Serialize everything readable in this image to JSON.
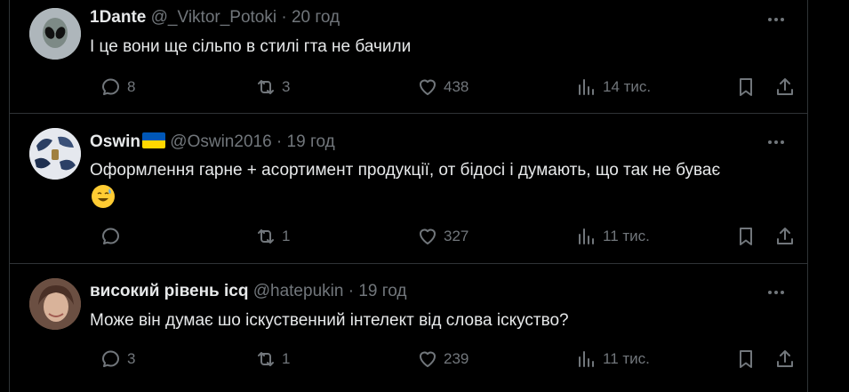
{
  "tweets": [
    {
      "name": "1Dante",
      "handle": "@_Viktor_Potoki",
      "separator": "·",
      "time": "20 год",
      "text": "І це вони ще сільпо в стилі гта не бачили",
      "replies": "8",
      "reposts": "3",
      "likes": "438",
      "views": "14 тис.",
      "avatar_icon": "alien-icon",
      "avatar_color": "#b9c0c5"
    },
    {
      "name": "Oswin",
      "name_flag": "ukraine-flag",
      "handle": "@Oswin2016",
      "separator": "·",
      "time": "19 год",
      "text": "Оформлення гарне + асортимент продукції, от бідосі і думають, що так не буває",
      "text_emoji": "grinning-sweat-emoji",
      "replies": "",
      "reposts": "1",
      "likes": "327",
      "views": "11 тис.",
      "avatar_icon": "artwork-avatar",
      "avatar_color": "#d9dde4"
    },
    {
      "name": "високий рівень icq",
      "handle": "@hatepukin",
      "separator": "·",
      "time": "19 год",
      "text": "Може він думає шо іскуственний інтелект від слова іскуство?",
      "replies": "3",
      "reposts": "1",
      "likes": "239",
      "views": "11 тис.",
      "avatar_icon": "photo-avatar",
      "avatar_color": "#8a6a58"
    }
  ],
  "colors": {
    "background": "#000000",
    "text": "#e7e9ea",
    "muted": "#71767b",
    "border": "#2f3336",
    "flag_blue": "#0057b7",
    "flag_yellow": "#ffd700"
  }
}
